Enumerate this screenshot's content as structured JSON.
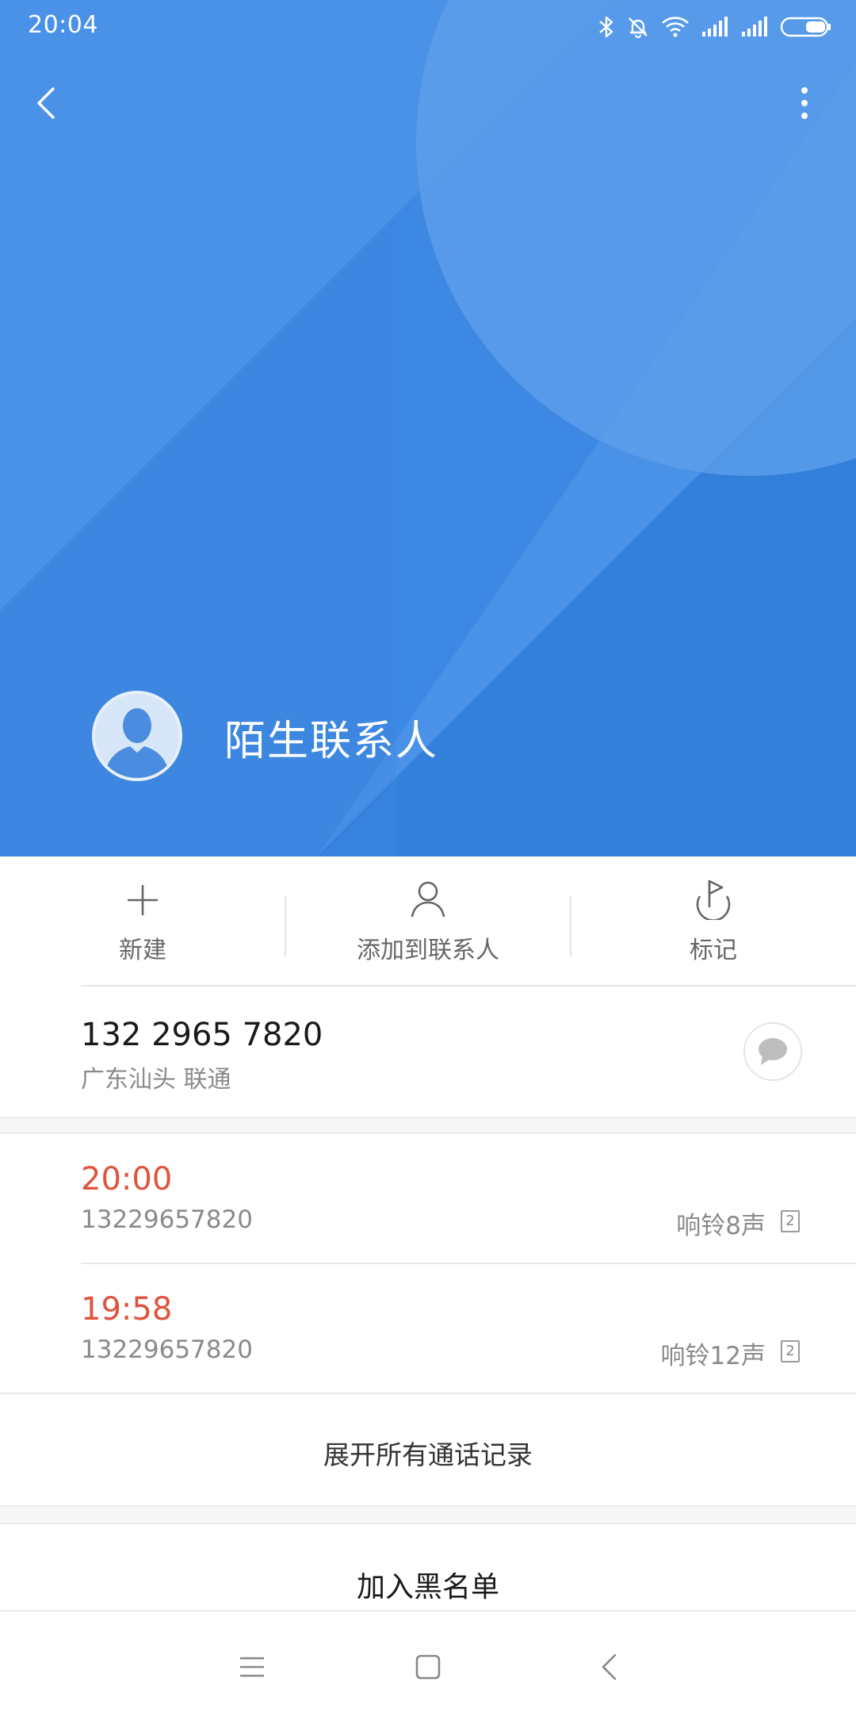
{
  "status_bar": {
    "time": "20:04",
    "icons": [
      "bluetooth-icon",
      "bell-muted-icon",
      "wifi-icon",
      "signal-icon",
      "signal-icon",
      "battery-icon"
    ]
  },
  "header": {
    "accent_color": "#4a92e8",
    "back_icon": "chevron-left-icon",
    "more_icon": "more-vertical-icon",
    "contact_name": "陌生联系人",
    "avatar_icon": "person-silhouette-icon"
  },
  "actions": [
    {
      "label": "新建",
      "icon": "plus-icon"
    },
    {
      "label": "添加到联系人",
      "icon": "person-outline-icon"
    },
    {
      "label": "标记",
      "icon": "flag-icon"
    }
  ],
  "phone": {
    "number": "132 2965 7820",
    "location": "广东汕头 联通",
    "message_icon": "message-bubble-icon"
  },
  "call_log": [
    {
      "time": "20:00",
      "number": "13229657820",
      "rings": "响铃8声",
      "sim": "2"
    },
    {
      "time": "19:58",
      "number": "13229657820",
      "rings": "响铃12声",
      "sim": "2"
    }
  ],
  "call_time_color": "#e0533d",
  "expand_label": "展开所有通话记录",
  "blacklist_label": "加入黑名单",
  "nav_bar": {
    "menu_icon": "menu-icon",
    "home_icon": "home-square-icon",
    "back_icon": "back-chevron-icon"
  }
}
